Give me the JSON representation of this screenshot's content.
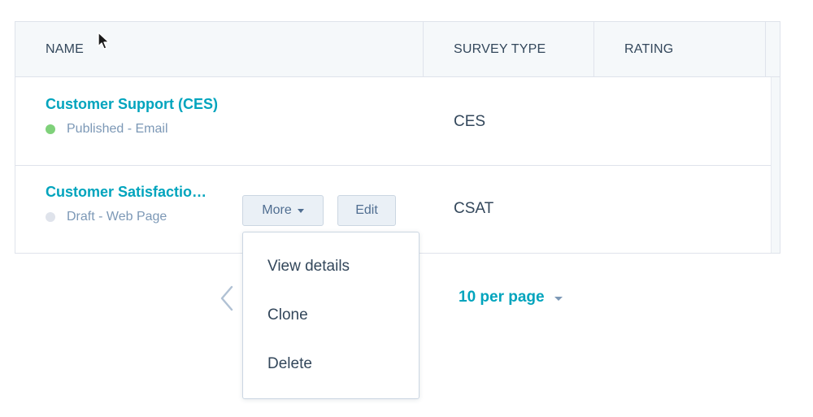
{
  "table": {
    "columns": {
      "name": "NAME",
      "survey_type": "SURVEY TYPE",
      "rating": "RATING"
    },
    "rows": [
      {
        "name": "Customer Support (CES)",
        "status": "Published - Email",
        "status_color": "#7fd17a",
        "survey_type": "CES"
      },
      {
        "name": "Customer Satisfactio…",
        "status": "Draft - Web Page",
        "status_color": "#dfe3eb",
        "survey_type": "CSAT",
        "actions": {
          "more": "More",
          "edit": "Edit"
        }
      }
    ]
  },
  "menu": {
    "items": [
      "View details",
      "Clone",
      "Delete"
    ]
  },
  "pagination": {
    "per_page": "10 per page"
  },
  "colors": {
    "accent": "#00a4bd",
    "text": "#33475b",
    "muted": "#7c98b6",
    "border": "#dfe3eb"
  },
  "icons": [
    "chevron-left-icon",
    "caret-down-icon",
    "mouse-cursor-icon"
  ]
}
